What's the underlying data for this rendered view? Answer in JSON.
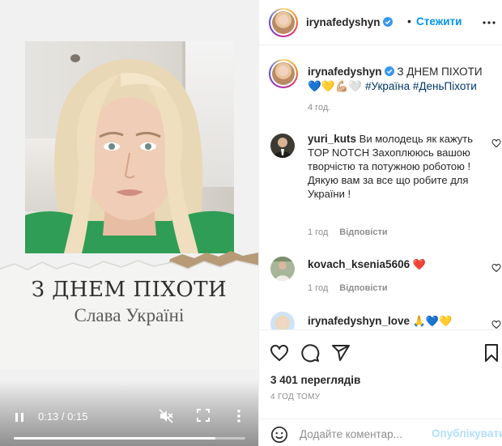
{
  "video": {
    "overlay_title": "З ДНЕМ ПІХОТИ",
    "overlay_subtitle": "Слава Україні",
    "time_display": "0:13 / 0:15",
    "progress": 0.87
  },
  "header": {
    "username": "irynafedyshyn",
    "dot": "•",
    "follow_label": "Стежити"
  },
  "caption": {
    "username": "irynafedyshyn",
    "text": "З ДНЕМ ПІХОТИ 💙💛💪🏼🤍",
    "hashtags": "#Україна #ДеньПіхоти",
    "time": "4 год."
  },
  "comments": [
    {
      "username": "yuri_kuts",
      "text": "Ви молодець як кажуть TOP NOTCH Захоплююсь вашою творчістю та потужною роботою ! Дякую вам за все що робите для України !",
      "time": "1 год",
      "reply": "Відповісти"
    },
    {
      "username": "kovach_ksenia5606",
      "text": "❤️",
      "time": "1 год",
      "reply": "Відповісти"
    },
    {
      "username": "irynafedyshyn_love",
      "text": "🙏💙💛",
      "time": "",
      "reply": ""
    }
  ],
  "stats": {
    "views": "3 401 переглядів",
    "time_ago": "4 ГОД ТОМУ"
  },
  "comment_box": {
    "placeholder": "Додайте коментар...",
    "publish_label": "Опублікувати"
  },
  "colors": {
    "link_blue": "#0095f6",
    "hashtag": "#00376b",
    "muted": "#8e8e8e"
  },
  "icons": [
    "pause-icon",
    "mute-icon",
    "fullscreen-icon",
    "more-vert-icon",
    "verified-icon",
    "more-horiz-icon",
    "heart-icon",
    "comment-icon",
    "share-icon",
    "bookmark-icon",
    "emoji-icon"
  ]
}
